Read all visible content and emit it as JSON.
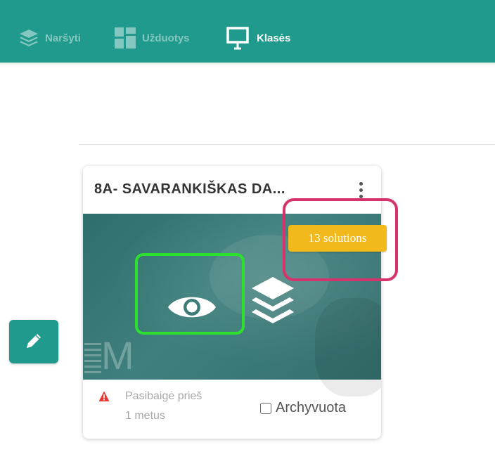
{
  "colors": {
    "topbar": "#1f9a8c",
    "badge": "#f2b91d",
    "highlight_green": "#2ee02e",
    "highlight_pink": "#d6336c",
    "warning": "#e53935"
  },
  "nav": {
    "items": [
      {
        "label": "Naršyti",
        "icon": "layers-icon",
        "active": false
      },
      {
        "label": "Užduotys",
        "icon": "grid-icon",
        "active": false
      },
      {
        "label": "Klasės",
        "icon": "presentation-board-icon",
        "active": true
      }
    ]
  },
  "card": {
    "title": "8A- SAVARANKIŠKAS DA...",
    "solutions_badge": "13 solutions",
    "watermark": "M",
    "status_text": "Pasibaigė prieš 1 metus",
    "archive_label": "Archyvuota",
    "archived": false,
    "icons": [
      "eye-icon",
      "layers-icon",
      "warning-triangle-icon",
      "kebab-menu-icon"
    ]
  },
  "edit_button": {
    "icon": "pencil-icon"
  }
}
